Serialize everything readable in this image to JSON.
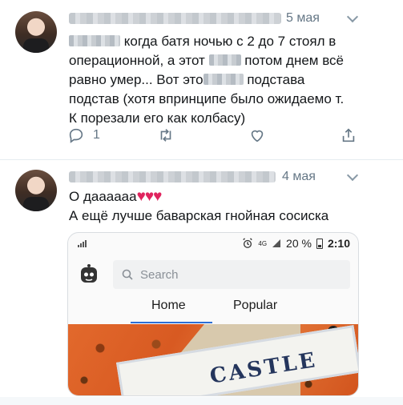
{
  "tweet1": {
    "date": "5 мая",
    "lines": [
      "когда батя  ночью с 2 до 7 стоял в",
      "операционной, а этот",
      "потом днем всё",
      "равно умер... Вот это",
      "подстава",
      "подстав (хотя впринципе было ожидаемо т.",
      "К порезали его как колбасу)"
    ],
    "reply_count": "1"
  },
  "tweet2": {
    "date": "4 мая",
    "line1": "О даааааа",
    "hearts": "♥♥♥",
    "line2": "А ещё лучше баварская гнойная сосиска"
  },
  "embed": {
    "status": {
      "battery": "20 %",
      "time": "2:10",
      "network": "4G"
    },
    "search_placeholder": "Search",
    "tabs": [
      "Home",
      "Popular"
    ],
    "card_text": "CASTLE"
  },
  "colors": {
    "muted": "#657786",
    "heart": "#e0245e",
    "tab_accent": "#2b6fd6"
  }
}
